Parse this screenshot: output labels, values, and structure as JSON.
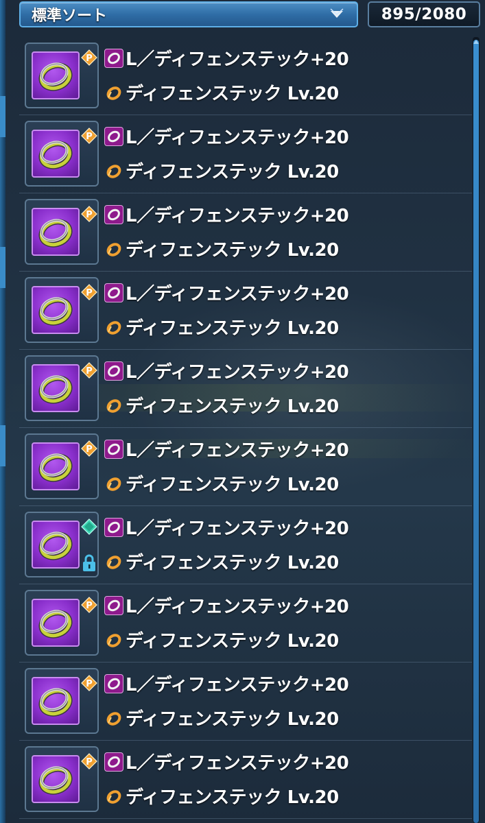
{
  "header": {
    "sort_label": "標準ソート",
    "item_count": "895/2080"
  },
  "items": [
    {
      "name": "L／ディフェンステック+20",
      "ability": "ディフェンステック Lv.20",
      "badge": "premium-p",
      "locked": false
    },
    {
      "name": "L／ディフェンステック+20",
      "ability": "ディフェンステック Lv.20",
      "badge": "premium-p",
      "locked": false
    },
    {
      "name": "L／ディフェンステック+20",
      "ability": "ディフェンステック Lv.20",
      "badge": "premium-p",
      "locked": false
    },
    {
      "name": "L／ディフェンステック+20",
      "ability": "ディフェンステック Lv.20",
      "badge": "premium-p",
      "locked": false
    },
    {
      "name": "L／ディフェンステック+20",
      "ability": "ディフェンステック Lv.20",
      "badge": "premium-p",
      "locked": false
    },
    {
      "name": "L／ディフェンステック+20",
      "ability": "ディフェンステック Lv.20",
      "badge": "premium-p",
      "locked": false
    },
    {
      "name": "L／ディフェンステック+20",
      "ability": "ディフェンステック Lv.20",
      "badge": "diamond-gem",
      "locked": true
    },
    {
      "name": "L／ディフェンステック+20",
      "ability": "ディフェンステック Lv.20",
      "badge": "premium-p",
      "locked": false
    },
    {
      "name": "L／ディフェンステック+20",
      "ability": "ディフェンステック Lv.20",
      "badge": "premium-p",
      "locked": false
    },
    {
      "name": "L／ディフェンステック+20",
      "ability": "ディフェンステック Lv.20",
      "badge": "premium-p",
      "locked": false
    }
  ],
  "colors": {
    "accent_blue": "#3a8fd0",
    "item_purple": "#8a2fcc",
    "ring_yellow": "#c8d23a",
    "premium_orange": "#f0a030",
    "gem_teal": "#3ed6b4",
    "lock_cyan": "#4cc0e8"
  }
}
